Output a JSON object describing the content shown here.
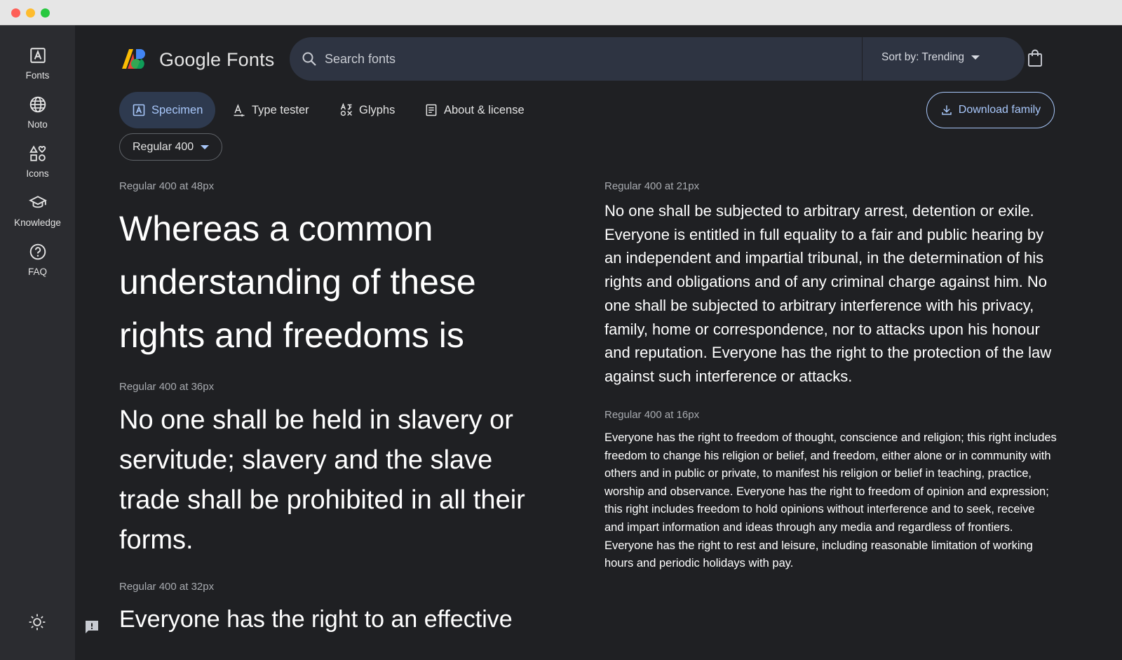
{
  "window": {
    "controls": [
      "close",
      "minimize",
      "maximize"
    ]
  },
  "sidebar": {
    "items": [
      {
        "label": "Fonts",
        "icon": "font-a-icon"
      },
      {
        "label": "Noto",
        "icon": "globe-icon"
      },
      {
        "label": "Icons",
        "icon": "shapes-icon"
      },
      {
        "label": "Knowledge",
        "icon": "school-icon"
      },
      {
        "label": "FAQ",
        "icon": "help-icon"
      }
    ],
    "theme_icon": "sun-icon"
  },
  "header": {
    "brand": "Google Fonts",
    "search": {
      "placeholder": "Search fonts",
      "value": ""
    },
    "sort_label": "Sort by: Trending",
    "cart_icon": "shopping-bag-icon"
  },
  "tabs": [
    {
      "label": "Specimen",
      "icon": "font-a-icon",
      "active": true
    },
    {
      "label": "Type tester",
      "icon": "type-tester-icon",
      "active": false
    },
    {
      "label": "Glyphs",
      "icon": "glyphs-icon",
      "active": false
    },
    {
      "label": "About & license",
      "icon": "article-icon",
      "active": false
    }
  ],
  "download_label": "Download family",
  "variant": {
    "selected": "Regular 400"
  },
  "specimens": [
    {
      "label": "Regular 400 at 48px",
      "text": "Whereas a common understanding of these rights and freedoms is"
    },
    {
      "label": "Regular 400 at 36px",
      "text": "No one shall be held in slavery or servitude; slavery and the slave trade shall be prohibited in all their forms."
    },
    {
      "label": "Regular 400 at 32px",
      "text": "Everyone has the right to an effective"
    },
    {
      "label": "Regular 400 at 21px",
      "text": "No one shall be subjected to arbitrary arrest, detention or exile. Everyone is entitled in full equality to a fair and public hearing by an independent and impartial tribunal, in the determination of his rights and obligations and of any criminal charge against him. No one shall be subjected to arbitrary interference with his privacy, family, home or correspondence, nor to attacks upon his honour and reputation. Everyone has the right to the protection of the law against such interference or attacks."
    },
    {
      "label": "Regular 400 at 16px",
      "text": "Everyone has the right to freedom of thought, conscience and religion; this right includes freedom to change his religion or belief, and freedom, either alone or in community with others and in public or private, to manifest his religion or belief in teaching, practice, worship and observance. Everyone has the right to freedom of opinion and expression; this right includes freedom to hold opinions without interference and to seek, receive and impart information and ideas through any media and regardless of frontiers. Everyone has the right to rest and leisure, including reasonable limitation of working hours and periodic holidays with pay."
    }
  ],
  "colors": {
    "background": "#1f2023",
    "sidebar": "#2b2c30",
    "search": "#2e3442",
    "accent": "#a8c7fa",
    "active_tab": "#2e3a4f"
  }
}
